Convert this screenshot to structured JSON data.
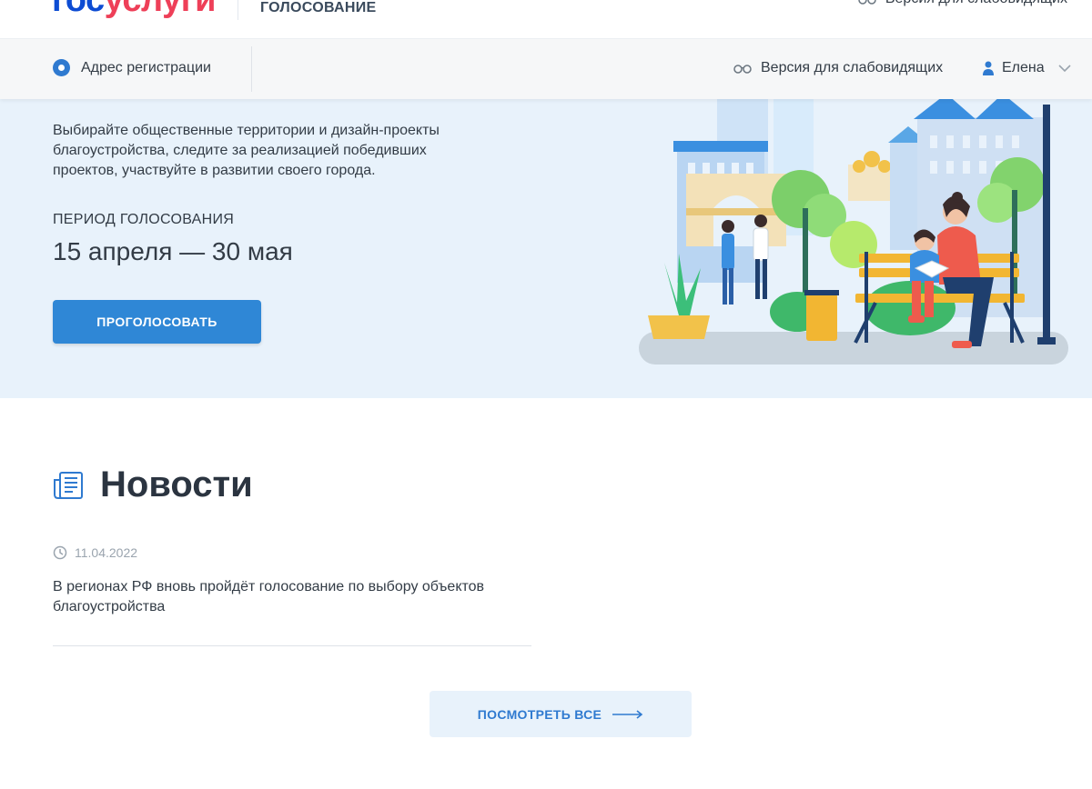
{
  "header": {
    "logo_part1": "гос",
    "logo_part2": "услуги",
    "service_title": "ГОЛОСОВАНИЕ",
    "vision_label": "Версия для слабовидящих"
  },
  "subheader": {
    "address_label": "Адрес регистрации",
    "vision_label": "Версия для слабовидящих",
    "user_name": "Елена"
  },
  "hero": {
    "description": "Выбирайте общественные территории и дизайн-проекты благоустройства, следите за реализацией победивших проектов, участвуйте в развитии своего города.",
    "period_label": "ПЕРИОД ГОЛОСОВАНИЯ",
    "period_value": "15 апреля — 30 мая",
    "vote_button": "ПРОГОЛОСОВАТЬ"
  },
  "news": {
    "title": "Новости",
    "items": [
      {
        "date": "11.04.2022",
        "text": "В регионах РФ вновь пройдёт голосование по выбору объектов благоустройства"
      }
    ],
    "view_all": "ПОСМОТРЕТЬ ВСЕ"
  },
  "icons": [
    "glasses-icon",
    "radio-dot-icon",
    "user-icon",
    "chevron-down-icon",
    "newspaper-icon",
    "clock-icon",
    "arrow-right-icon"
  ],
  "colors": {
    "brand_blue": "#0d4cd3",
    "brand_red": "#ee3f58",
    "primary_button": "#2f87d6",
    "hero_bg": "#e8f2fb",
    "text": "#333c46"
  }
}
